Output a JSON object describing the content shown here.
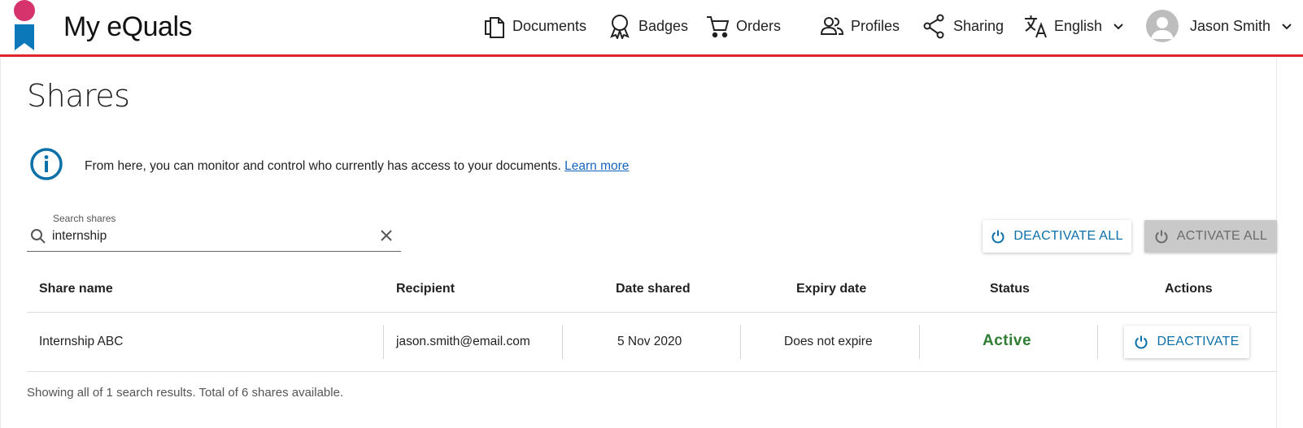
{
  "brand": {
    "name": "My eQuals",
    "accent_color": "#e0242d",
    "logo_circle_color": "#d6336c",
    "logo_ribbon_color": "#0a78b9"
  },
  "nav": {
    "documents": "Documents",
    "badges": "Badges",
    "orders": "Orders",
    "profiles": "Profiles",
    "sharing": "Sharing",
    "language": "English",
    "user_name": "Jason Smith"
  },
  "page": {
    "title": "Shares",
    "info_text": "From here, you can monitor and control who currently has access to your documents.",
    "learn_more": "Learn more"
  },
  "search": {
    "label": "Search shares",
    "value": "internship"
  },
  "actions": {
    "deactivate_all": "DEACTIVATE ALL",
    "activate_all": "ACTIVATE ALL"
  },
  "table": {
    "headers": {
      "share_name": "Share name",
      "recipient": "Recipient",
      "date_shared": "Date shared",
      "expiry_date": "Expiry date",
      "status": "Status",
      "actions": "Actions"
    },
    "rows": [
      {
        "share_name": "Internship ABC",
        "recipient": "jason.smith@email.com",
        "date_shared": "5 Nov 2020",
        "expiry_date": "Does not expire",
        "status": "Active",
        "action": "DEACTIVATE"
      }
    ]
  },
  "footer": {
    "results_text": "Showing all of 1 search results. Total of 6 shares available."
  },
  "colors": {
    "status_active": "#2e7d32",
    "action_blue": "#0b6fa8",
    "link_blue": "#1565c0",
    "disabled_button": "#c9c9c9"
  }
}
